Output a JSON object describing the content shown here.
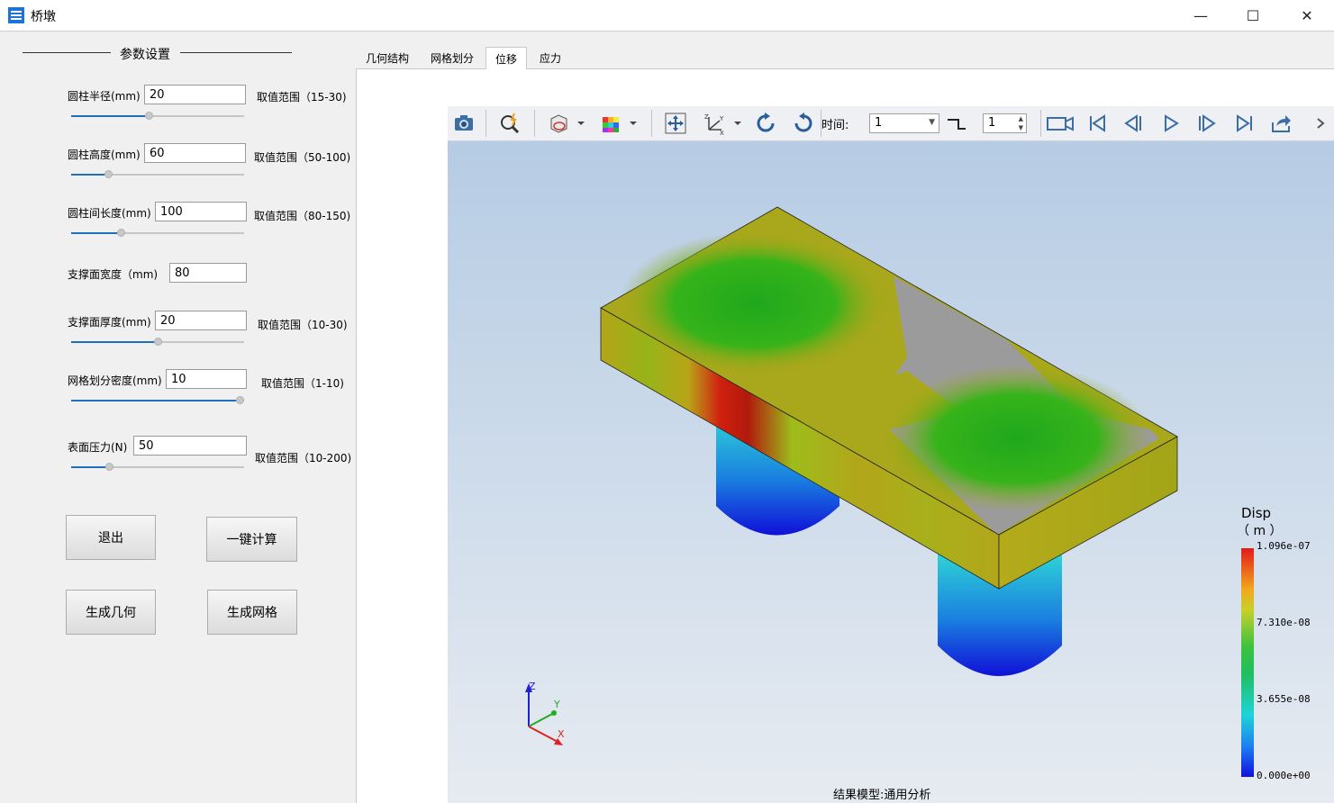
{
  "window": {
    "title": "桥墩",
    "minimize": "—",
    "maximize": "☐",
    "close": "✕"
  },
  "params": {
    "group_title": "参数设置",
    "radius": {
      "label": "圆柱半径(mm)",
      "value": "20",
      "range": "取值范围（15-30)",
      "slider": 0.45
    },
    "height": {
      "label": "圆柱高度(mm)",
      "value": "60",
      "range": "取值范围（50-100)",
      "slider": 0.2
    },
    "spacing": {
      "label": "圆柱间长度(mm)",
      "value": "100",
      "range": "取值范围（80-150)",
      "slider": 0.28
    },
    "support_width": {
      "label": "支撑面宽度（mm)",
      "value": "80"
    },
    "support_thick": {
      "label": "支撑面厚度(mm)",
      "value": "20",
      "range": "取值范围（10-30)",
      "slider": 0.5
    },
    "mesh": {
      "label": "网格划分密度(mm)",
      "value": "10",
      "range": "取值范围（1-10)",
      "slider": 1.0
    },
    "pressure": {
      "label": "表面压力(N)",
      "value": "50",
      "range": "取值范围（10-200)",
      "slider": 0.21
    }
  },
  "buttons": {
    "exit": "退出",
    "compute": "一键计算",
    "gen_geom": "生成几何",
    "gen_mesh": "生成网格"
  },
  "tabs": [
    "几何结构",
    "网格划分",
    "位移",
    "应力"
  ],
  "active_tab": 2,
  "toolbar": {
    "time_label": "时间:",
    "time_value": "1",
    "step_value": "1"
  },
  "legend": {
    "title": "Disp",
    "unit": "（ m ）",
    "values": [
      "1.096e-07",
      "7.310e-08",
      "3.655e-08",
      "0.000e+00"
    ]
  },
  "axes": {
    "z": "Z",
    "y": "Y",
    "x": "X"
  },
  "status": "结果模型:通用分析"
}
